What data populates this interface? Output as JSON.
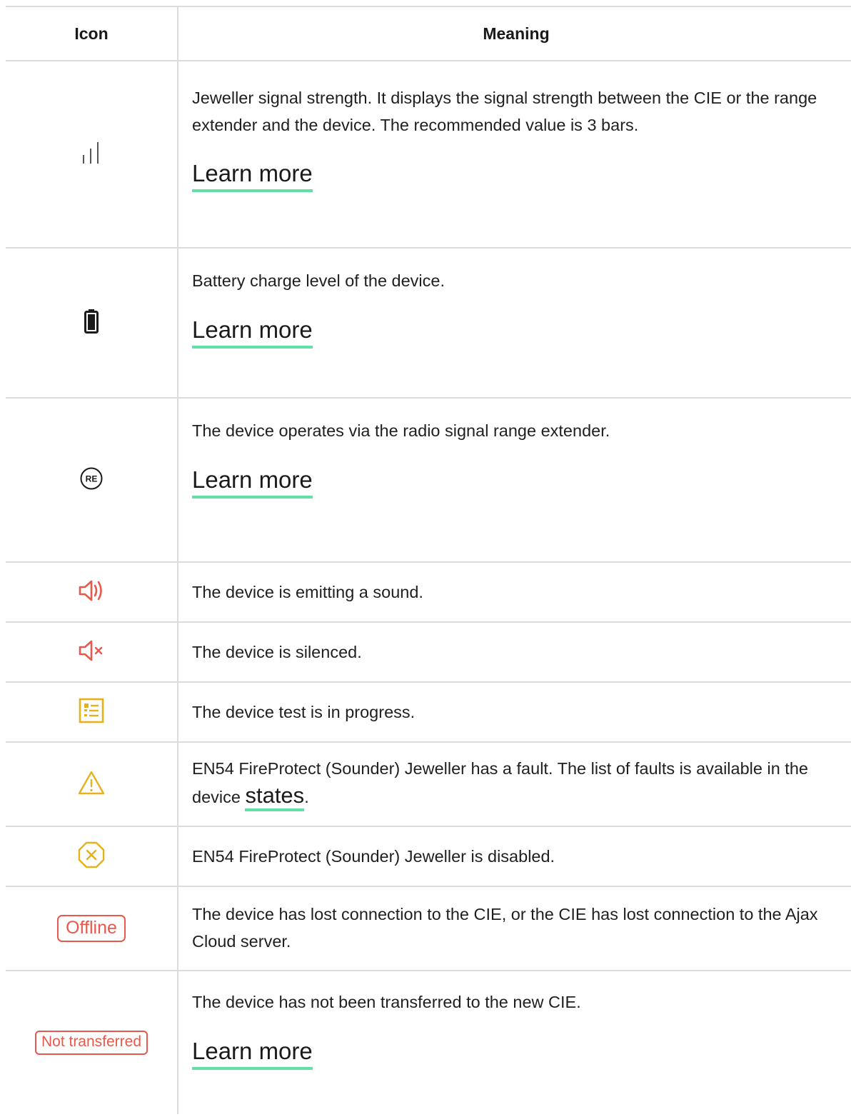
{
  "header": {
    "icon": "Icon",
    "meaning": "Meaning"
  },
  "rows": [
    {
      "icon": "signal-strength-icon",
      "text": "Jeweller signal strength. It displays the signal strength between the CIE or the range extender and the device. The recommended value is 3 bars.",
      "link": "Learn more"
    },
    {
      "icon": "battery-icon",
      "text": "Battery charge level of the device.",
      "link": "Learn more"
    },
    {
      "icon": "range-extender-icon",
      "text": "The device operates via the radio signal range extender.",
      "link": "Learn more"
    },
    {
      "icon": "sound-on-icon",
      "text": "The device is emitting a sound."
    },
    {
      "icon": "sound-muted-icon",
      "text": "The device is silenced."
    },
    {
      "icon": "test-list-icon",
      "text": "The device test is in progress."
    },
    {
      "icon": "warning-icon",
      "text": "EN54 FireProtect (Sounder) Jeweller has a fault. The list of faults is available in the device ",
      "link": "states",
      "suffix": "."
    },
    {
      "icon": "disabled-icon",
      "text": "EN54 FireProtect (Sounder) Jeweller is disabled."
    },
    {
      "badge": "Offline",
      "text": "The device has lost connection to the CIE, or the CIE has lost connection to the Ajax Cloud server."
    },
    {
      "badge": "Not transferred",
      "text": "The device has not been transferred to the new CIE.",
      "link": "Learn more"
    }
  ],
  "colors": {
    "red": "#e8584c",
    "yellow": "#e5b21b",
    "link_underline": "#5fe0a4",
    "border": "#dcdcdc"
  }
}
